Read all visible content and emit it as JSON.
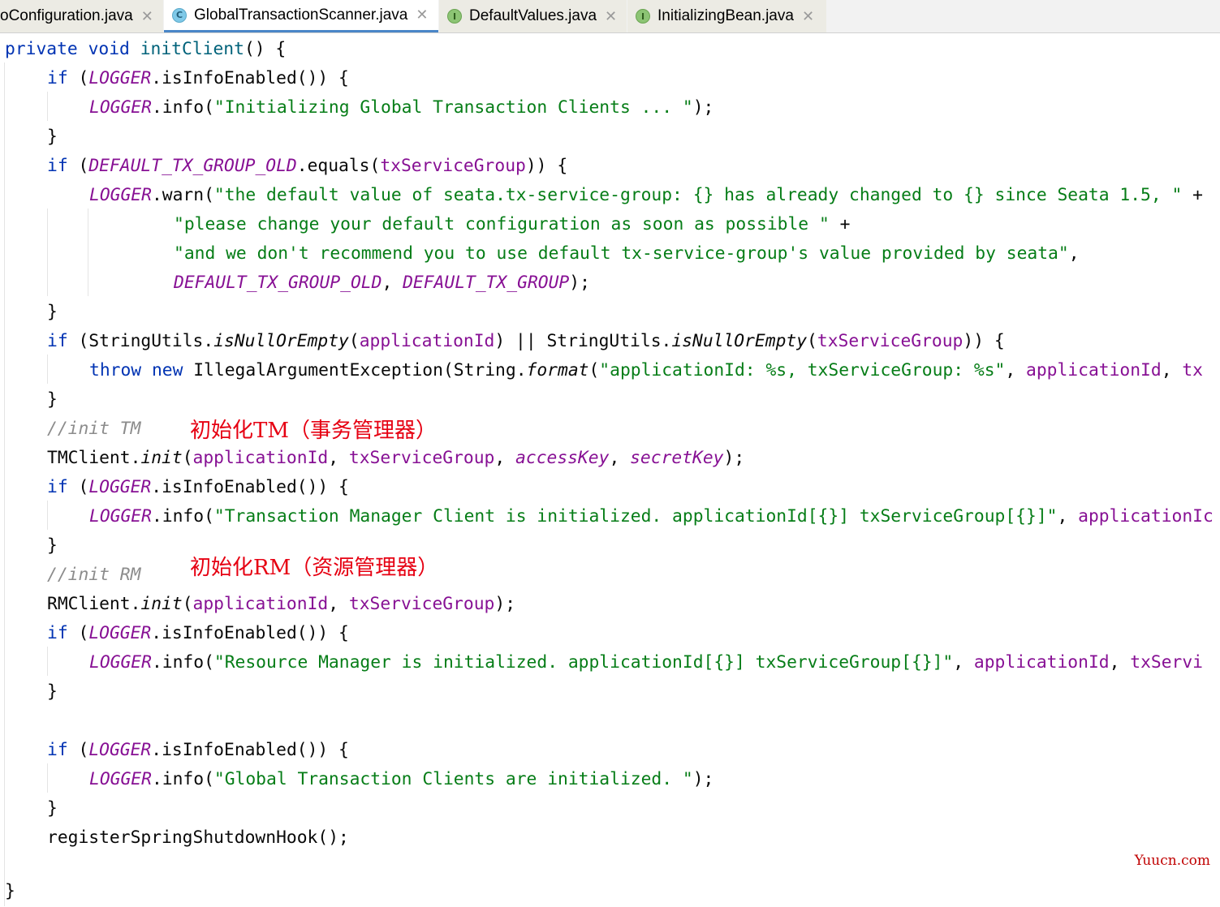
{
  "tabs": [
    {
      "label": "oConfiguration.java",
      "icon": "none"
    },
    {
      "label": "GlobalTransactionScanner.java",
      "icon": "class-icon",
      "icon_glyph": "C",
      "active": true
    },
    {
      "label": "DefaultValues.java",
      "icon": "interface-icon",
      "icon_glyph": "I"
    },
    {
      "label": "InitializingBean.java",
      "icon": "interface-icon",
      "icon_glyph": "I"
    }
  ],
  "close_glyph": "✕",
  "code": {
    "l1": [
      "private",
      "void",
      "initClient",
      "() {"
    ],
    "l2": [
      "if",
      " (",
      "LOGGER",
      ".",
      "isInfoEnabled",
      "()) {"
    ],
    "l3": [
      "LOGGER",
      ".",
      "info",
      "(",
      "\"Initializing Global Transaction Clients ... \"",
      ");"
    ],
    "l4": "}",
    "l5": [
      "if",
      " (",
      "DEFAULT_TX_GROUP_OLD",
      ".",
      "equals",
      "(",
      "txServiceGroup",
      ")) {"
    ],
    "l6": [
      "LOGGER",
      ".",
      "warn",
      "(",
      "\"the default value of seata.tx-service-group: {} has already changed to {} since Seata 1.5, \"",
      " +"
    ],
    "l7": [
      "\"please change your default configuration as soon as possible \"",
      " +"
    ],
    "l8": [
      "\"and we don't recommend you to use default tx-service-group's value provided by seata\"",
      ","
    ],
    "l9": [
      "DEFAULT_TX_GROUP_OLD",
      ", ",
      "DEFAULT_TX_GROUP",
      ");"
    ],
    "l10": "}",
    "l11": [
      "if",
      " (StringUtils.",
      "isNullOrEmpty",
      "(",
      "applicationId",
      ") || StringUtils.",
      "isNullOrEmpty",
      "(",
      "txServiceGroup",
      ")) {"
    ],
    "l12": [
      "throw",
      "new",
      " IllegalArgumentException(String.",
      "format",
      "(",
      "\"applicationId: %s, txServiceGroup: %s\"",
      ", ",
      "applicationId",
      ", ",
      "tx"
    ],
    "l13": "}",
    "l14": "//init TM",
    "l15": [
      "TMClient.",
      "init",
      "(",
      "applicationId",
      ", ",
      "txServiceGroup",
      ", ",
      "accessKey",
      ", ",
      "secretKey",
      ");"
    ],
    "l16": [
      "if",
      " (",
      "LOGGER",
      ".",
      "isInfoEnabled",
      "()) {"
    ],
    "l17": [
      "LOGGER",
      ".",
      "info",
      "(",
      "\"Transaction Manager Client is initialized. applicationId[{}] txServiceGroup[{}]\"",
      ", ",
      "applicationIc"
    ],
    "l18": "}",
    "l19": "//init RM",
    "l20": [
      "RMClient.",
      "init",
      "(",
      "applicationId",
      ", ",
      "txServiceGroup",
      ");"
    ],
    "l21": [
      "if",
      " (",
      "LOGGER",
      ".",
      "isInfoEnabled",
      "()) {"
    ],
    "l22": [
      "LOGGER",
      ".",
      "info",
      "(",
      "\"Resource Manager is initialized. applicationId[{}] txServiceGroup[{}]\"",
      ", ",
      "applicationId",
      ", ",
      "txServi"
    ],
    "l23": "}",
    "l24": [
      "if",
      " (",
      "LOGGER",
      ".",
      "isInfoEnabled",
      "()) {"
    ],
    "l25": [
      "LOGGER",
      ".",
      "info",
      "(",
      "\"Global Transaction Clients are initialized. \"",
      ");"
    ],
    "l26": "}",
    "l27": "registerSpringShutdownHook();",
    "l28": "}"
  },
  "annotations": {
    "tm": "初始化TM（事务管理器）",
    "rm": "初始化RM（资源管理器）"
  },
  "watermark": "Yuucn.com",
  "colors": {
    "keyword": "#0033b3",
    "field": "#871094",
    "string": "#067d17",
    "method": "#00627a",
    "comment": "#8c8c8c",
    "annotation": "#e60012",
    "active_tab_underline": "#4a86c8"
  }
}
